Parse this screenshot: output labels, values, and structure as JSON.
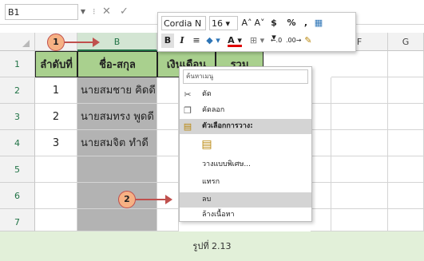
{
  "formula_bar": {
    "name_box": "B1",
    "cancel_icon": "✕",
    "enter_icon": "✓"
  },
  "columns": [
    "A",
    "B",
    "C",
    "D",
    "E",
    "F",
    "G"
  ],
  "rows": [
    "1",
    "2",
    "3",
    "4",
    "5",
    "6",
    "7"
  ],
  "table": {
    "headers": [
      "ลำดับที่",
      "ชื่อ-สกุล",
      "เงินเดือน",
      "รวม"
    ],
    "data": [
      {
        "no": "1",
        "name": "นายสมชาย คิดดี"
      },
      {
        "no": "2",
        "name": "นายสมทรง พูดดี"
      },
      {
        "no": "3",
        "name": "นายสมจิต ทำดี"
      }
    ]
  },
  "mini_toolbar": {
    "font": "Cordia N ▾",
    "size": "16 ▾",
    "grow_font": "A˄",
    "shrink_font": "A˅",
    "currency": "$ ▾",
    "percent": "%",
    "comma": ",",
    "bold": "B",
    "italic": "I",
    "align": "≡",
    "fill_color": "◆ ▾",
    "font_color": "A ▾",
    "borders": "⊞ ▾",
    "increase_decimal": "←.0",
    "decrease_decimal": ".00→"
  },
  "context_menu": {
    "search_placeholder": "ค้นหาเมนู",
    "items": [
      {
        "label": "ตัด",
        "icon": "scissors-icon"
      },
      {
        "label": "คัดลอก",
        "icon": "copy-icon"
      },
      {
        "label": "ตัวเลือกการวาง:",
        "icon": "paste-icon"
      },
      {
        "label": "",
        "icon": "clipboard-icon"
      },
      {
        "label": "วางแบบพิเศษ...",
        "icon": ""
      },
      {
        "label": "แทรก",
        "icon": ""
      },
      {
        "label": "ลบ",
        "icon": ""
      },
      {
        "label": "ล้างเนื้อหา",
        "icon": ""
      }
    ]
  },
  "callouts": {
    "one": "1",
    "two": "2"
  },
  "caption": "รูปที่ 2.13",
  "colors": {
    "header_green": "#a9d08e",
    "selected_gray": "#b3b3b3",
    "callout_fill": "#f6b184",
    "callout_border": "#c0504d",
    "caption_bg": "#e2f0d9",
    "menu_highlight": "#d4d4d4"
  }
}
